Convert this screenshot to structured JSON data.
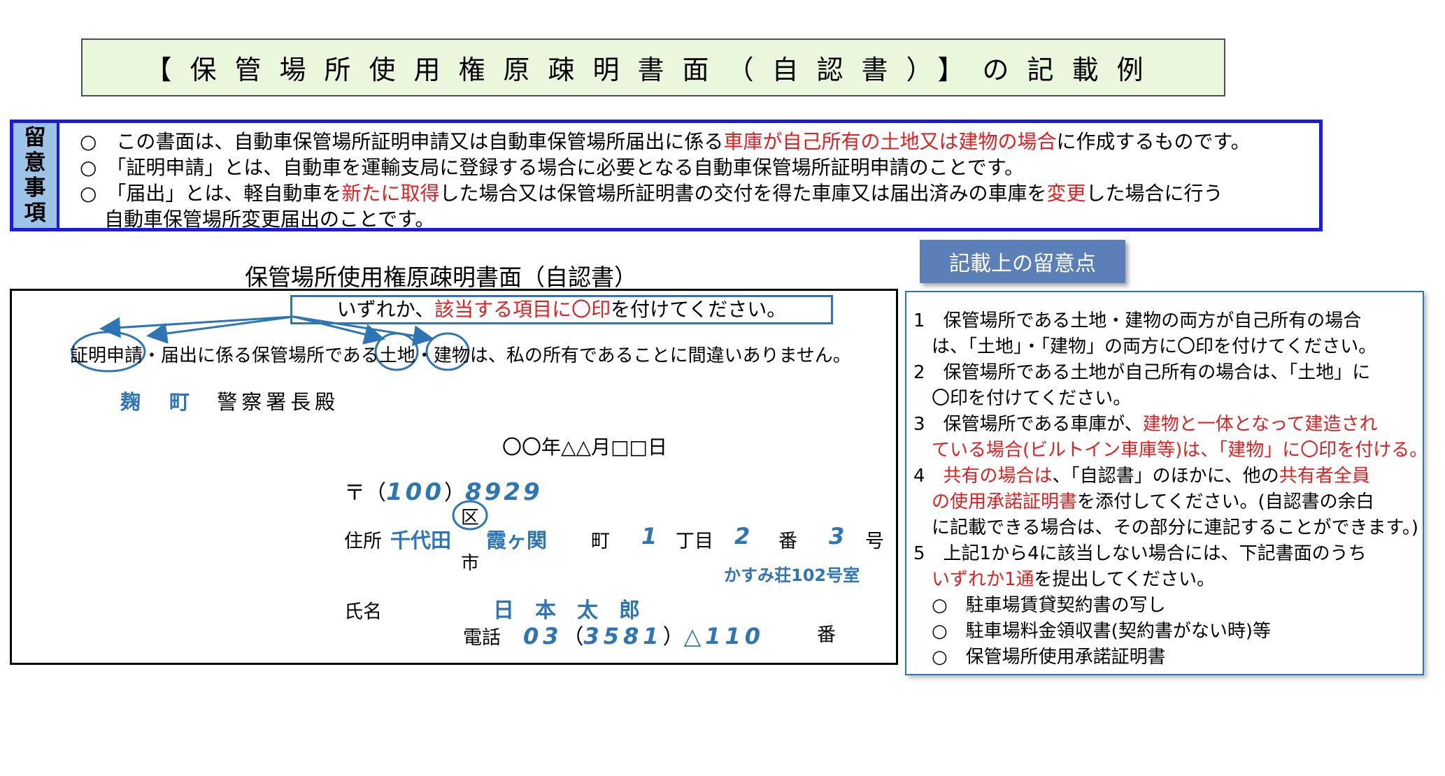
{
  "title": "【保管場所使用権原疎明書面（自認書）】の記載例",
  "notes": {
    "label": [
      "留",
      "意",
      "事",
      "項"
    ],
    "line1": {
      "prefix": "○　この書面は、自動車保管場所証明申請又は自動車保管場所届出に係る",
      "highlight": "車庫が自己所有の土地又は建物の場合",
      "suffix": "に作成するものです。"
    },
    "line2": "○　「証明申請」とは、自動車を運輸支局に登録する場合に必要となる自動車保管場所証明申請のことです。",
    "line3": {
      "p1": "○　「届出」とは、軽自動車を",
      "h1": "新たに取得",
      "p2": "した場合又は保管場所証明書の交付を得た車庫又は届出済みの車庫を",
      "h2": "変更",
      "p3": "した場合に行う"
    },
    "line4": "自動車保管場所変更届出のことです。"
  },
  "form": {
    "heading": "保管場所使用権原疎明書面（自認書）",
    "instruction": {
      "prefix": "いずれか、",
      "highlight": "該当する項目に〇印",
      "suffix": "を付けてください。"
    },
    "statement": {
      "opt_shomei": "証明申請",
      "dot1": "・",
      "opt_todoke": "届出に係る保管場所である",
      "opt_tochi": "土地",
      "dot2": "・",
      "opt_tatemono": "建物",
      "rest": "は、私の所有であることに間違いありません。"
    },
    "police_name": "麹　町",
    "police_suffix": "警察署長殿",
    "date": "〇〇年△△月□□日",
    "postal_label": "〒（",
    "postal_first": "100",
    "postal_close": "）",
    "postal_second": "8929",
    "ward_kanji": "区",
    "city_kanji": "市",
    "address_label": "住所",
    "address_city": "千代田",
    "address_town": "霞ヶ関",
    "machi": "町",
    "chome_num": "1",
    "chome": "丁目",
    "ban_num": "2",
    "ban": "番",
    "go_num": "3",
    "go": "号",
    "building": "かすみ荘102号室",
    "name_label": "氏名",
    "name_value": "日　本　太　郎",
    "phone_label": "電話",
    "phone_area": "03",
    "phone_open": "（",
    "phone_mid": "3581",
    "phone_close": "）",
    "phone_last": "△110",
    "phone_suffix": "番"
  },
  "side": {
    "header": "記載上の留意点",
    "l1": "1　保管場所である土地・建物の両方が自己所有の場合",
    "l2": "　は、「土地」・「建物」の両方に〇印を付けてください。",
    "l3": "2　保管場所である土地が自己所有の場合は、「土地」に",
    "l4": "　〇印を付けてください。",
    "l5a": "3　保管場所である車庫が、",
    "l5b": "建物と一体となって建造され",
    "l6": "　ている場合(ビルトイン車庫等)は、「建物」に〇印を付ける。",
    "l7a": "4　",
    "l7b": "共有の場合は",
    "l7c": "、「自認書」のほかに、他の",
    "l7d": "共有者全員",
    "l8a": "　の使用承諾証明書",
    "l8b": "を添付してください。(自認書の余白",
    "l9": "　に記載できる場合は、その部分に連記することができます。)",
    "l10": "5　上記1から4に該当しない場合には、下記書面のうち",
    "l11a": "　いずれか1通",
    "l11b": "を提出してください。",
    "l12": "　○　駐車場賃貸契約書の写し",
    "l13": "　○　駐車場料金領収書(契約書がない時)等",
    "l14": "　○　保管場所使用承諾証明書"
  },
  "colors": {
    "accent_blue": "#2e75b6",
    "notes_border": "#1a1ae6",
    "highlight_red": "#e02020",
    "banner_bg": "#ebf7dc",
    "side_header_bg": "#5b80b8"
  }
}
